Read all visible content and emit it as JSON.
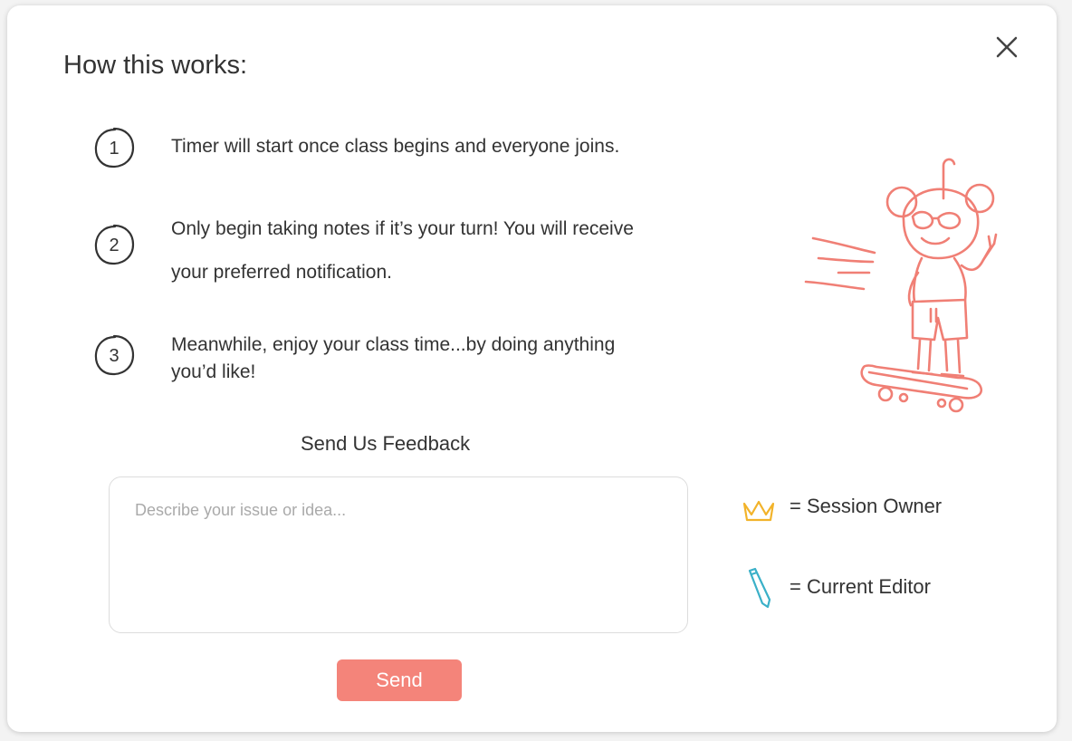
{
  "modal": {
    "title": "How this works:",
    "steps": [
      {
        "number": "1",
        "line1": "Timer will start once class begins and everyone joins.",
        "line2": ""
      },
      {
        "number": "2",
        "line1": "Only begin taking notes if it’s your turn! You will receive",
        "line2": "your preferred notification."
      },
      {
        "number": "3",
        "line1": "Meanwhile, enjoy your class time...by doing anything",
        "line2": "you’d like!"
      }
    ],
    "feedback": {
      "title": "Send Us Feedback",
      "placeholder": "Describe your issue or idea...",
      "send_label": "Send"
    },
    "legend": [
      {
        "icon": "crown-icon",
        "label": "= Session Owner",
        "color": "#f2b32a"
      },
      {
        "icon": "pencil-icon",
        "label": "= Current Editor",
        "color": "#3ab0c8"
      }
    ]
  },
  "colors": {
    "accent": "#f4847a",
    "mascot": "#f07f75"
  }
}
